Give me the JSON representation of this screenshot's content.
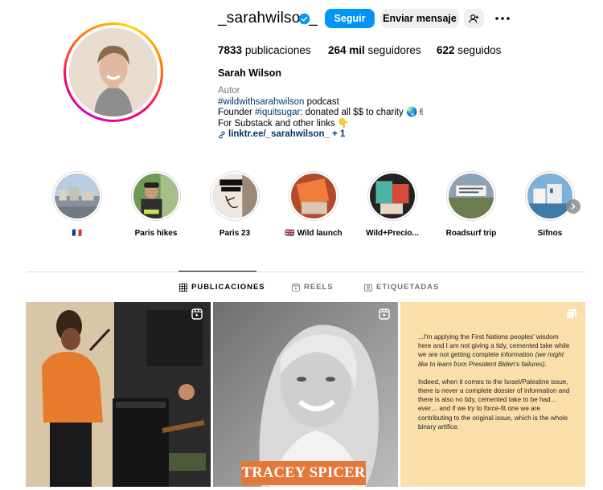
{
  "profile": {
    "username": "_sarahwilson_",
    "follow_label": "Seguir",
    "message_label": "Enviar mensaje",
    "stats": {
      "posts_count": "7833",
      "posts_label": "publicaciones",
      "followers_count": "264 mil",
      "followers_label": "seguidores",
      "following_count": "622",
      "following_label": "seguidos"
    },
    "full_name": "Sarah Wilson",
    "bio": {
      "category": "Autor",
      "line1_tag": "#wildwithsarahwilson",
      "line1_text": " podcast",
      "line2_prefix": "Founder ",
      "line2_tag": "#iquitsugar",
      "line2_text": ": donated all $$ to charity 🌏✌",
      "line3": "For Substack and other links 👇",
      "link": "linktr.ee/_sarahwilson_ + 1"
    }
  },
  "highlights": [
    {
      "label": "🇫🇷"
    },
    {
      "label": "Paris hikes"
    },
    {
      "label": "Paris 23"
    },
    {
      "label": "🇬🇧 Wild launch"
    },
    {
      "label": "Wild+Precio..."
    },
    {
      "label": "Roadsurf trip"
    },
    {
      "label": "Sifnos"
    }
  ],
  "tabs": [
    {
      "label": "PUBLICACIONES",
      "icon": "grid-icon"
    },
    {
      "label": "REELS",
      "icon": "reels-icon"
    },
    {
      "label": "ETIQUETADAS",
      "icon": "tagged-icon"
    }
  ],
  "posts": {
    "post2_banner": "TRACEY SPICER",
    "post3_para1_plain": "...I'm applying the First Nations peoples' wisdom here and I am not giving a tidy, cemented take while we are not getting complete information ",
    "post3_para1_italic": "(we might like to learn from President Biden's failures).",
    "post3_para2": "Indeed, when it comes to the Israel/Palestine issue, there is never a complete dossier of information and there is also no tidy, cemented take to be had… ever… and if we try to force-fit one we are contributing to the original issue, which is the whole binary artifice."
  },
  "colors": {
    "accent": "#0095f6",
    "button_secondary": "#efefef",
    "link": "#00376b",
    "post3_background": "#fbdfaa",
    "banner": "#e3783a"
  }
}
